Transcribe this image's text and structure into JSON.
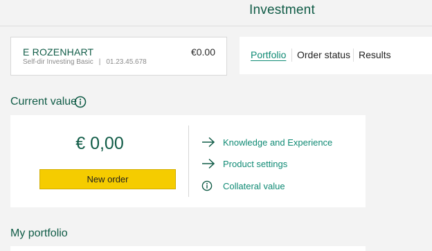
{
  "header": {
    "title": "Investment"
  },
  "account": {
    "name": "E ROZENHART",
    "balance": "€0.00",
    "product": "Self-dir Investing Basic",
    "separator": "|",
    "number": "01.23.45.678"
  },
  "tabs": [
    {
      "label": "Portfolio",
      "active": true
    },
    {
      "label": "Order status",
      "active": false
    },
    {
      "label": "Results",
      "active": false
    }
  ],
  "current_value": {
    "heading": "Current value",
    "amount": "€ 0,00",
    "new_order_label": "New order"
  },
  "links": [
    {
      "label": "Knowledge and Experience",
      "icon": "arrow-right-icon"
    },
    {
      "label": "Product settings",
      "icon": "arrow-right-icon"
    },
    {
      "label": "Collateral value",
      "icon": "info-icon"
    }
  ],
  "portfolio": {
    "heading": "My portfolio"
  },
  "colors": {
    "brand_green": "#0f5b46",
    "link_teal": "#0f8a74",
    "button_yellow": "#f5cc00"
  }
}
